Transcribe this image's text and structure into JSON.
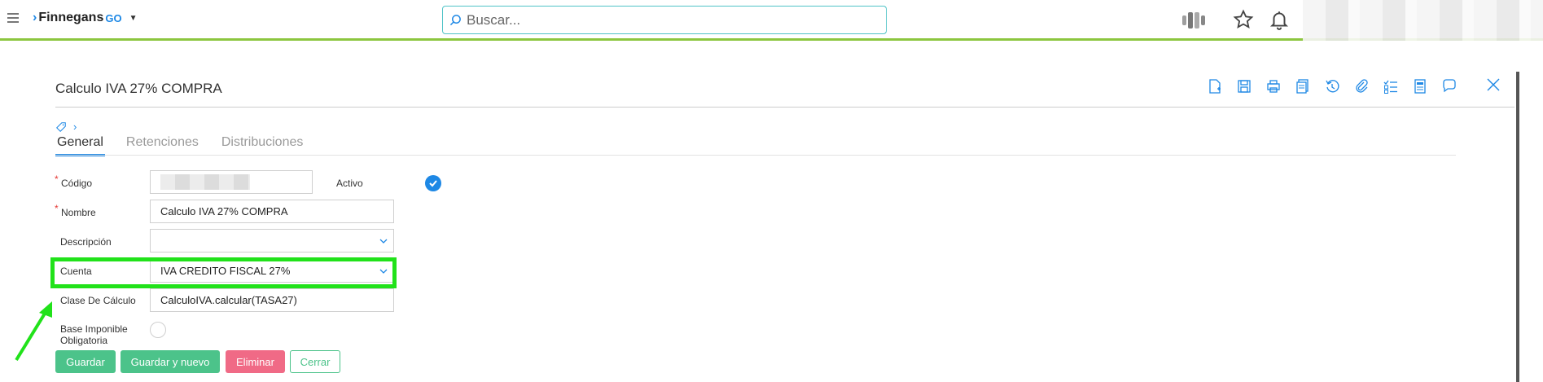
{
  "header": {
    "logo_text": "Finnegans",
    "logo_suffix": "GO",
    "search_placeholder": "Buscar..."
  },
  "form": {
    "title": "Calculo IVA 27% COMPRA",
    "tabs": [
      "General",
      "Retenciones",
      "Distribuciones"
    ],
    "fields": {
      "codigo": {
        "label": "Código",
        "value": ""
      },
      "activo": {
        "label": "Activo",
        "checked": true
      },
      "nombre": {
        "label": "Nombre",
        "value": "Calculo IVA 27% COMPRA"
      },
      "descripcion": {
        "label": "Descripción",
        "value": ""
      },
      "cuenta": {
        "label": "Cuenta",
        "value": "IVA CREDITO FISCAL 27%"
      },
      "clase_calculo": {
        "label": "Clase De Cálculo",
        "value": "CalculoIVA.calcular(TASA27)"
      },
      "base_imponible": {
        "label_line1": "Base Imponible",
        "label_line2": "Obligatoria",
        "checked": false
      }
    },
    "required_marker": "*",
    "buttons": {
      "guardar": "Guardar",
      "guardar_nuevo": "Guardar y nuevo",
      "eliminar": "Eliminar",
      "cerrar": "Cerrar"
    }
  },
  "toolbar_icons": [
    "new-document-icon",
    "save-icon",
    "print-icon",
    "copy-icon",
    "history-icon",
    "attach-icon",
    "checklist-icon",
    "report-icon",
    "comment-icon"
  ],
  "colors": {
    "accent": "#1e88e5",
    "brand_green_bar": "#8cc63f",
    "button_green": "#4cc38a",
    "button_red": "#f06a86",
    "annotation_highlight": "#21e21a"
  }
}
